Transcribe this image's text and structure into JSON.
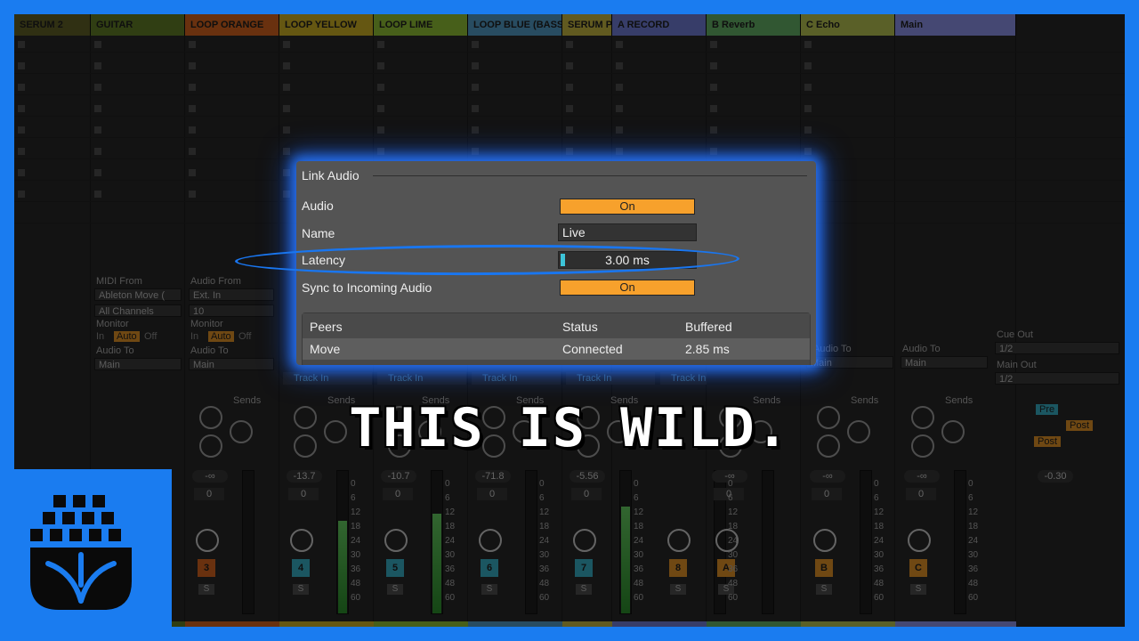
{
  "tracks": [
    {
      "name": "SERUM 2",
      "color": "#6b6b2b"
    },
    {
      "name": "GUITAR",
      "color": "#6b8a2a"
    },
    {
      "name": "LOOP ORANGE",
      "color": "#e96e22"
    },
    {
      "name": "LOOP YELLOW",
      "color": "#e0c028"
    },
    {
      "name": "LOOP LIME",
      "color": "#9ed23a"
    },
    {
      "name": "LOOP BLUE (BASS",
      "color": "#5aa9d8"
    },
    {
      "name": "SERUM PI",
      "color": "#d8c848"
    },
    {
      "name": "A RECORD",
      "color": "#7a88e8"
    },
    {
      "name": "B Reverb",
      "color": "#6ec070"
    },
    {
      "name": "C Echo",
      "color": "#c8d45a"
    },
    {
      "name": "Main",
      "color": "#9aa0ff"
    }
  ],
  "io": {
    "midi_from_label": "MIDI From",
    "midi_from_value": "Ableton Move (",
    "all_channels": "All Channels",
    "audio_from_label": "Audio From",
    "audio_from_value": "Ext. In",
    "audio_from_channel": "10",
    "monitor_label": "Monitor",
    "monitor_in": "In",
    "monitor_auto": "Auto",
    "monitor_off": "Off",
    "audio_to_label": "Audio To",
    "audio_to_value": "Main",
    "track_in": "Track In",
    "cue_out_label": "Cue Out",
    "cue_out_value": "1/2",
    "main_out_label": "Main Out",
    "main_out_value": "1/2",
    "pre": "Pre",
    "post": "Post",
    "sends": "Sends"
  },
  "mixer": [
    {
      "vol": "-∞",
      "num": "3",
      "color": "#e96e22",
      "level": 0
    },
    {
      "vol": "-13.7",
      "num": "4",
      "color": "#3dbfd8",
      "level": 0.65
    },
    {
      "vol": "-10.7",
      "num": "5",
      "color": "#3dbfd8",
      "level": 0.7
    },
    {
      "vol": "-71.8",
      "num": "6",
      "color": "#3dbfd8",
      "level": 0
    },
    {
      "vol": "-5.56",
      "num": "7",
      "color": "#3dbfd8",
      "level": 0.75
    },
    {
      "vol": "",
      "num": "8",
      "color": "#f7a12c",
      "level": 0
    },
    {
      "vol": "-∞",
      "num": "A",
      "color": "#f7a12c",
      "level": 0
    },
    {
      "vol": "-∞",
      "num": "B",
      "color": "#f7a12c",
      "level": 0
    },
    {
      "vol": "-∞",
      "num": "C",
      "color": "#f7a12c",
      "level": 0
    }
  ],
  "main_vol": "-0.30",
  "pan_value": "0",
  "meter_scale": [
    "0",
    "6",
    "12",
    "18",
    "24",
    "30",
    "36",
    "48",
    "60"
  ],
  "link_audio": {
    "title": "Link Audio",
    "audio_label": "Audio",
    "audio_value": "On",
    "name_label": "Name",
    "name_value": "Live",
    "latency_label": "Latency",
    "latency_value": "3.00 ms",
    "latency_fraction": 0.03,
    "sync_label": "Sync to Incoming Audio",
    "sync_value": "On",
    "peers": {
      "headers": [
        "Peers",
        "Status",
        "Buffered"
      ],
      "rows": [
        {
          "peer": "Move",
          "status": "Connected",
          "buffered": "2.85 ms"
        }
      ]
    }
  },
  "caption": "THIS IS WILD.",
  "accent_color": "#1a7cf0",
  "on_color": "#f7a12c"
}
